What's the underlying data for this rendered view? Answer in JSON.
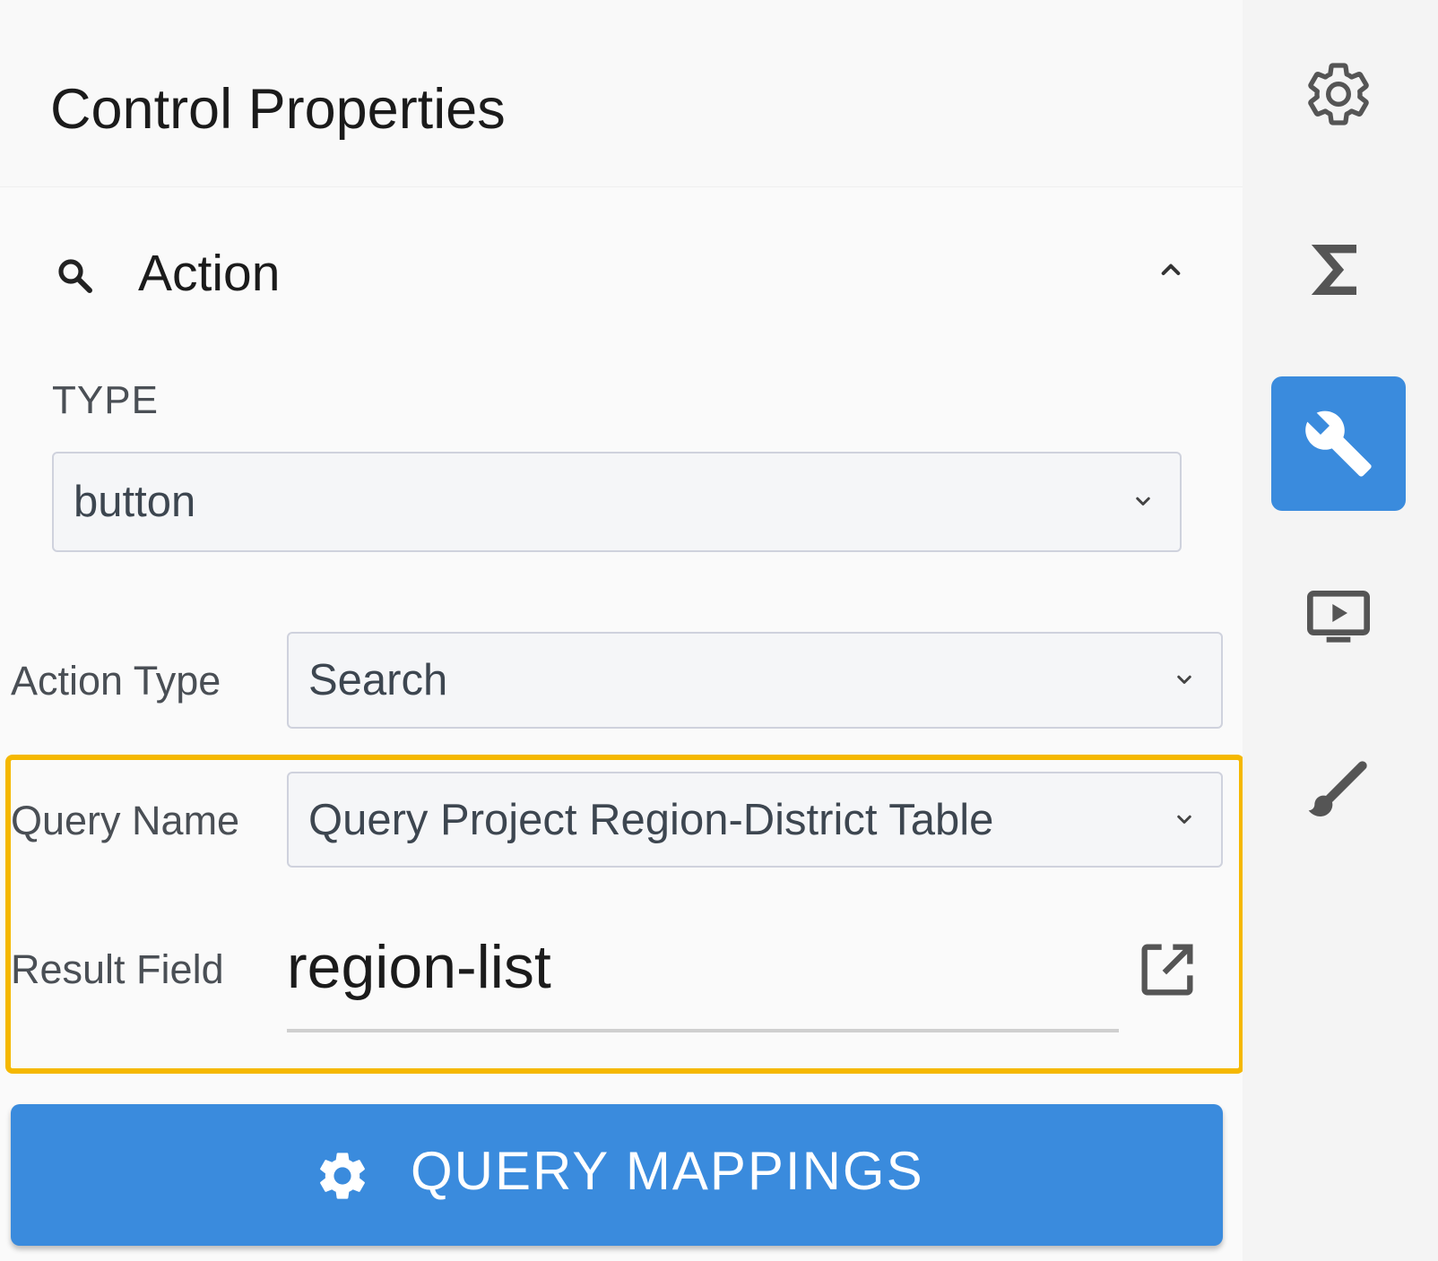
{
  "panel": {
    "title": "Control Properties",
    "section": {
      "title": "Action",
      "icon": "search-icon",
      "collapse_icon": "chevron-up-icon"
    },
    "type_field": {
      "label": "TYPE",
      "value": "button"
    },
    "action_type": {
      "label": "Action Type",
      "value": "Search"
    },
    "query_name": {
      "label": "Query Name",
      "value": "Query Project Region-District Table"
    },
    "result_field": {
      "label": "Result Field",
      "value": "region-list",
      "icon": "open-in-new-icon"
    },
    "primary_button": {
      "label": "QUERY MAPPINGS",
      "icon": "gear-icon"
    }
  },
  "rail": {
    "items": [
      {
        "icon": "gear-outline-icon",
        "active": false
      },
      {
        "icon": "sigma-icon",
        "active": false
      },
      {
        "icon": "wrench-icon",
        "active": true
      },
      {
        "icon": "play-screen-icon",
        "active": false
      },
      {
        "icon": "brush-icon",
        "active": false
      }
    ]
  },
  "colors": {
    "accent": "#3a8bdd",
    "highlight": "#f5b800",
    "panel_bg": "#fafafa",
    "rail_bg": "#f4f4f4"
  }
}
